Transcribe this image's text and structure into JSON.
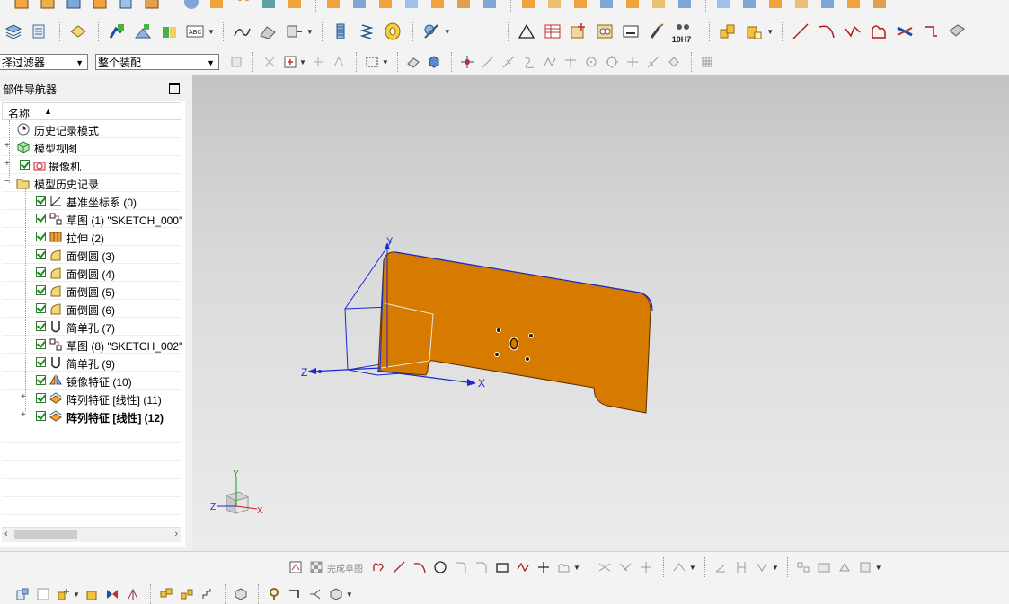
{
  "toolbar": {
    "filter_dropdown": "择过滤器",
    "assembly_dropdown": "整个装配",
    "tolerance_label": "10H7"
  },
  "navigator": {
    "title": "部件导航器",
    "column_name": "名称",
    "items": [
      {
        "label": "历史记录模式",
        "icon": "clock-icon",
        "level": 0
      },
      {
        "label": "模型视图",
        "icon": "model-views-icon",
        "level": 0
      },
      {
        "label": "摄像机",
        "icon": "camera-icon",
        "level": 0
      },
      {
        "label": "模型历史记录",
        "icon": "folder-open-icon",
        "level": 0
      },
      {
        "label": "基准坐标系 (0)",
        "icon": "datum-csys-icon",
        "level": 1
      },
      {
        "label": "草图 (1) \"SKETCH_000\"",
        "icon": "sketch-icon",
        "level": 1
      },
      {
        "label": "拉伸 (2)",
        "icon": "extrude-icon",
        "level": 1
      },
      {
        "label": "面倒圆 (3)",
        "icon": "face-blend-icon",
        "level": 1
      },
      {
        "label": "面倒圆 (4)",
        "icon": "face-blend-icon",
        "level": 1
      },
      {
        "label": "面倒圆 (5)",
        "icon": "face-blend-icon",
        "level": 1
      },
      {
        "label": "面倒圆 (6)",
        "icon": "face-blend-icon",
        "level": 1
      },
      {
        "label": "简单孔 (7)",
        "icon": "simple-hole-icon",
        "level": 1
      },
      {
        "label": "草图 (8) \"SKETCH_002\"",
        "icon": "sketch-icon",
        "level": 1
      },
      {
        "label": "简单孔 (9)",
        "icon": "simple-hole-icon",
        "level": 1
      },
      {
        "label": "镜像特征 (10)",
        "icon": "mirror-feature-icon",
        "level": 1
      },
      {
        "label": "阵列特征 [线性] (11)",
        "icon": "pattern-feature-icon",
        "level": 1
      },
      {
        "label": "阵列特征 [线性] (12)",
        "icon": "pattern-feature-icon",
        "level": 1
      }
    ]
  },
  "viewport": {
    "axis_x": "X",
    "axis_y": "Y",
    "axis_z": "Z",
    "part_color": "#d67a00",
    "background_top": "#c4c4c4",
    "background_bottom": "#ececec"
  },
  "sketch_toolbar": {
    "finish_label": "完成草图"
  }
}
